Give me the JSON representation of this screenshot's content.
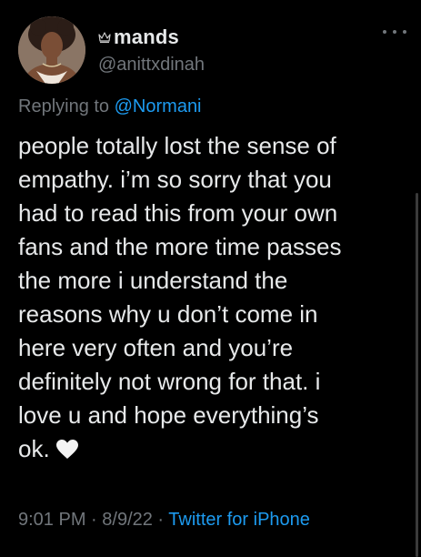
{
  "user": {
    "display_name": "mands",
    "handle": "@anittxdinah",
    "avatar_icon": "profile-photo",
    "badge_icon": "crown-icon"
  },
  "reply": {
    "prefix": "Replying to ",
    "mention": "@Normani"
  },
  "tweet": {
    "lines": [
      "people totally lost the sense of",
      "empathy. i’m so sorry that you",
      "had to read this from your own",
      "fans and the more time passes",
      "the more i understand the",
      "reasons why u don’t come in",
      "here very often and you’re",
      "definitely not wrong for that. i",
      "love u and hope everything’s",
      "ok."
    ],
    "emoji": "white-heart-icon"
  },
  "meta": {
    "time": "9:01 PM",
    "sep1": " · ",
    "date": "8/9/22",
    "sep2": " · ",
    "source": "Twitter for iPhone"
  },
  "colors": {
    "background": "#000000",
    "text": "#e7e9ea",
    "muted": "#71767b",
    "link": "#1d9bf0"
  }
}
